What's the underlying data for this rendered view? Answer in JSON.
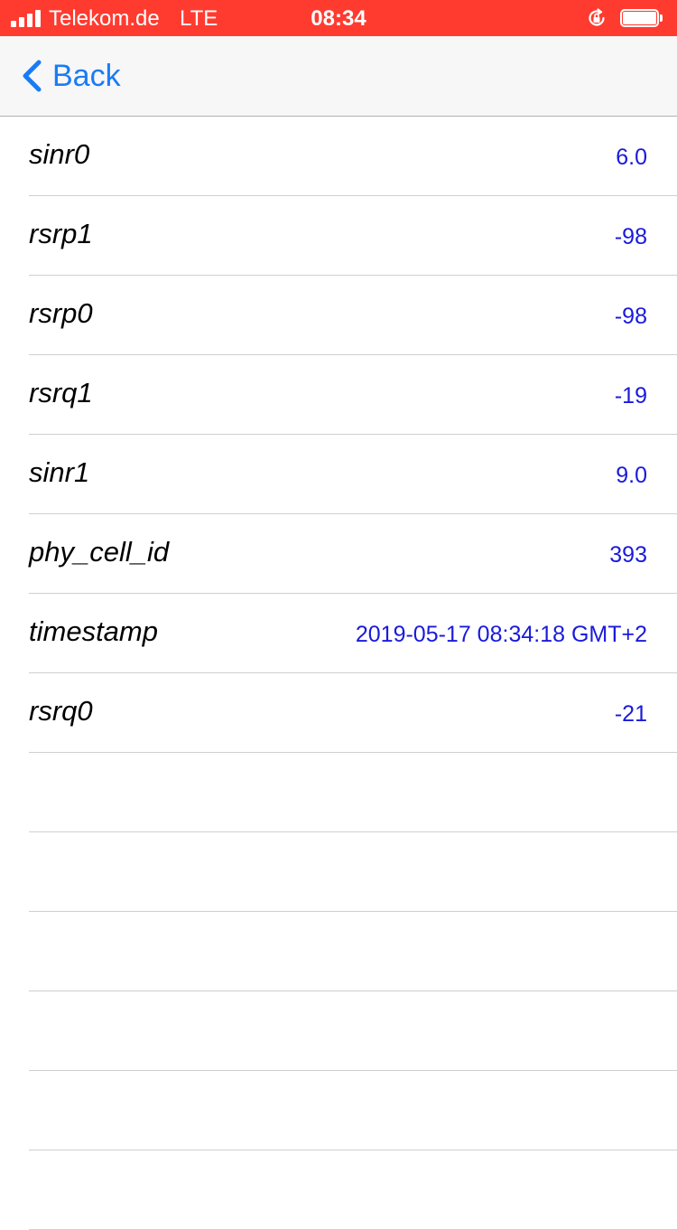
{
  "status_bar": {
    "carrier": "Telekom.de",
    "network_type": "LTE",
    "time": "08:34",
    "background_color": "#ff3b30",
    "icons": [
      "signal-bars-icon",
      "rotation-lock-icon",
      "battery-icon"
    ]
  },
  "nav": {
    "back_label": "Back",
    "accent_color": "#1a7cf5",
    "icons": [
      "chevron-left-icon"
    ]
  },
  "rows": [
    {
      "label": "sinr0",
      "value": "6.0"
    },
    {
      "label": "rsrp1",
      "value": "-98"
    },
    {
      "label": "rsrp0",
      "value": "-98"
    },
    {
      "label": "rsrq1",
      "value": "-19"
    },
    {
      "label": "sinr1",
      "value": "9.0"
    },
    {
      "label": "phy_cell_id",
      "value": "393"
    },
    {
      "label": "timestamp",
      "value": "2019-05-17 08:34:18 GMT+2"
    },
    {
      "label": "rsrq0",
      "value": "-21"
    },
    {
      "label": "",
      "value": ""
    },
    {
      "label": "",
      "value": ""
    },
    {
      "label": "",
      "value": ""
    },
    {
      "label": "",
      "value": ""
    },
    {
      "label": "",
      "value": ""
    },
    {
      "label": "",
      "value": ""
    }
  ],
  "value_color": "#1a1adb"
}
